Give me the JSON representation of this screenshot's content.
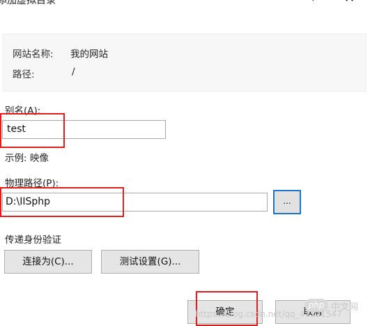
{
  "window": {
    "title": "添加虚拟目录",
    "help_glyph": "?",
    "close_glyph": "✕"
  },
  "info": {
    "site_name_label": "网站名称:",
    "site_name_value": "我的网站",
    "path_label": "路径:",
    "path_value": "/"
  },
  "alias": {
    "label": "别名(A):",
    "value": "test",
    "example": "示例: 映像"
  },
  "physical_path": {
    "label": "物理路径(P):",
    "value": "D:\\IISphp",
    "browse_label": "..."
  },
  "auth": {
    "label": "传递身份验证",
    "connect_as_label": "连接为(C)...",
    "test_settings_label": "测试设置(G)..."
  },
  "footer": {
    "ok_label": "确定",
    "cancel_label": "取消"
  },
  "watermark": {
    "logo_text": "php",
    "site_text": "中文网",
    "url_text": "https://blog.csdn.net/qq_41121547"
  },
  "colors": {
    "highlight_box": "#e21c1c",
    "focus_border": "#1a74c8"
  }
}
